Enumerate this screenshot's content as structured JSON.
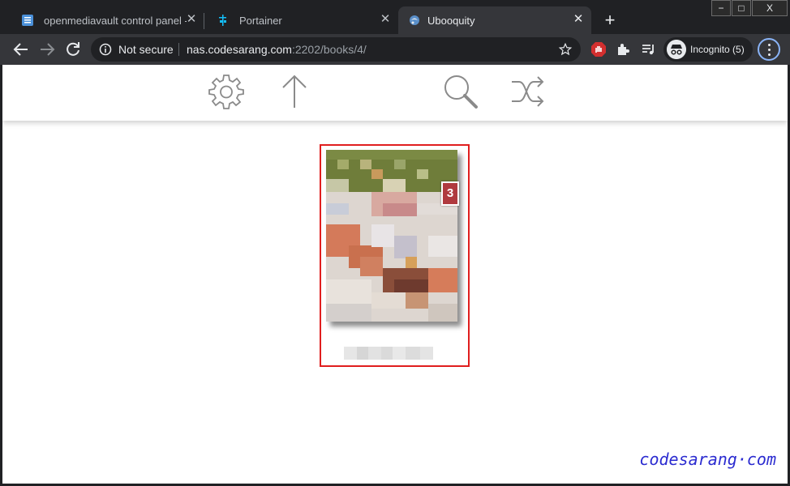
{
  "browser": {
    "tabs": [
      {
        "title": "openmediavault control panel - ",
        "active": false
      },
      {
        "title": "Portainer",
        "active": false
      },
      {
        "title": "Ubooquity",
        "active": true
      }
    ],
    "security_label": "Not secure",
    "url_host": "nas.codesarang.com",
    "url_path": ":2202/books/4/",
    "profile_label": "Incognito (5)",
    "window_controls": {
      "minimize": "−",
      "maximize": "□",
      "close": "X"
    }
  },
  "app": {
    "header_icons": [
      "settings-icon",
      "up-arrow-icon",
      "search-icon",
      "shuffle-icon"
    ]
  },
  "book": {
    "badge_count": "3"
  },
  "watermark": "codesarang·com",
  "colors": {
    "selection_border": "#e01e1e",
    "badge": "#b03a3f",
    "watermark": "#2b2bd0",
    "chrome_dark": "#202124",
    "chrome_toolbar": "#35363a"
  }
}
